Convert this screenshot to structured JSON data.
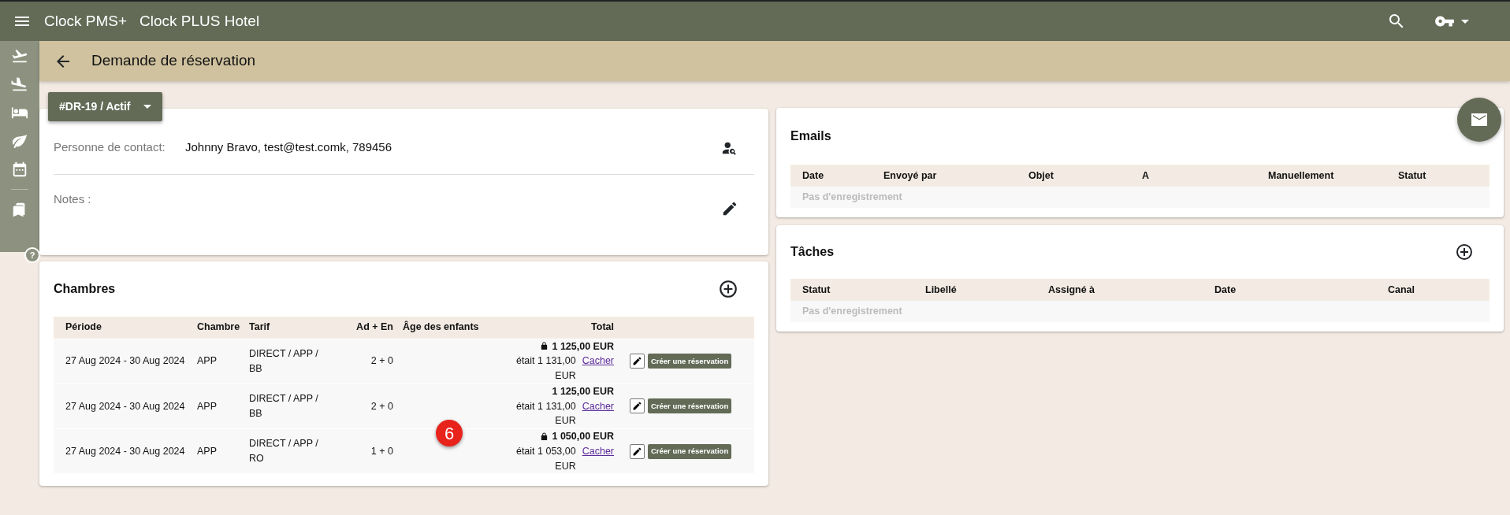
{
  "app_bar": {
    "product": "Clock PMS+",
    "hotel": "Clock PLUS Hotel"
  },
  "sidebar": {
    "help_label": "?"
  },
  "page_header": {
    "title": "Demande de réservation"
  },
  "status_button": {
    "label": "#DR-19 / Actif"
  },
  "contact": {
    "label": "Personne de contact:",
    "value": "Johnny Bravo, test@test.comk, 789456"
  },
  "notes": {
    "label": "Notes :"
  },
  "rooms": {
    "title": "Chambres",
    "columns": [
      "Période",
      "Chambre",
      "Tarif",
      "Ad + En",
      "Âge des enfants",
      "Total"
    ],
    "rows": [
      {
        "period": "27 Aug 2024 - 30 Aug 2024",
        "room": "APP",
        "rate": "DIRECT / APP / BB",
        "guests": "2 + 0",
        "total": "1 125,00 EUR",
        "locked": true,
        "previous": "était 1 131,00 EUR",
        "hide_link": "Cacher",
        "action": "Créer une réservation"
      },
      {
        "period": "27 Aug 2024 - 30 Aug 2024",
        "room": "APP",
        "rate": "DIRECT / APP / BB",
        "guests": "2 + 0",
        "total": "1 125,00 EUR",
        "locked": false,
        "previous": "était 1 131,00 EUR",
        "hide_link": "Cacher",
        "action": "Créer une réservation"
      },
      {
        "period": "27 Aug 2024 - 30 Aug 2024",
        "room": "APP",
        "rate": "DIRECT / APP / RO",
        "guests": "1 + 0",
        "total": "1 050,00 EUR",
        "locked": true,
        "previous": "était 1 053,00 EUR",
        "hide_link": "Cacher",
        "action": "Créer une réservation"
      }
    ]
  },
  "annotation": {
    "label": "6"
  },
  "emails": {
    "title": "Emails",
    "columns": [
      "Date",
      "Envoyé par",
      "Objet",
      "A",
      "Manuellement",
      "Statut"
    ],
    "empty": "Pas d'enregistrement"
  },
  "tasks": {
    "title": "Tâches",
    "columns": [
      "Statut",
      "Libellé",
      "Assigné à",
      "Date",
      "Canal"
    ],
    "empty": "Pas d'enregistrement"
  }
}
